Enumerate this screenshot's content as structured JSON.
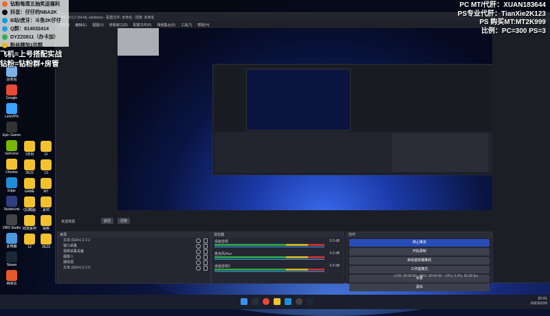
{
  "overlay": {
    "lines": [
      {
        "text": "钻粉每周五抽奖送福利",
        "color": "#e86b2c"
      },
      {
        "text": "抖音：仔仔的NBA2K",
        "color": "#111111"
      },
      {
        "text": "B站/虎牙：斗鱼2K仔仔",
        "color": "#00a1d6"
      },
      {
        "text": "Q群：814032414",
        "color": "#1aa0e6"
      },
      {
        "text": "DYZZ0811（办卡加）",
        "color": "#2bb24c"
      },
      {
        "text": "粉丝牌加1拉群",
        "color": "#e9b616"
      }
    ],
    "promo": [
      "飞机=上号搭配实战",
      "钻粉=钻粉群+房管"
    ]
  },
  "top_right": [
    "PC MT/代肝：XUAN183644",
    "PS专业代肝：TianXie2K123",
    "PS 购买MT:MT2K999",
    "比例：PC=300 PS=3"
  ],
  "desktop": {
    "icons": [
      {
        "label": "回收站",
        "color": "#7fb0e8"
      },
      {
        "label": "Google",
        "color": "#e84a3a"
      },
      {
        "label": "LetsVPN",
        "color": "#3aa2ff"
      },
      {
        "label": "Epic Games",
        "color": "#333333"
      },
      {
        "label": "GeForce",
        "color": "#76b900"
      },
      {
        "label": "Chrome",
        "color": "#f2c12e"
      },
      {
        "label": "Edge",
        "color": "#1f8ed8"
      },
      {
        "label": "StudioLink",
        "color": "#2f3f7f"
      },
      {
        "label": "OBS Studio",
        "color": "#444444"
      },
      {
        "label": "此电脑",
        "color": "#4a9adf"
      },
      {
        "label": "Steam",
        "color": "#1b2838"
      },
      {
        "label": "网易云",
        "color": "#e85a2a"
      }
    ],
    "folders": [
      "1年份",
      "2K22",
      "GAME",
      "QQ截图",
      "收费素材",
      "12",
      "11",
      "13",
      "MT",
      "素材",
      "视频",
      "2K23"
    ]
  },
  "obs": {
    "title": "OBS 29.0.2 (64-bit, windows) - 配置文件: 未命名 - 场景: 未命名",
    "menu": [
      "文件(F)",
      "编辑(E)",
      "视图(V)",
      "停靠窗口(D)",
      "配置文件(P)",
      "场景集合(S)",
      "工具(T)",
      "帮助(H)"
    ],
    "no_source": "未选择源",
    "props_button": "属性",
    "filter_button": "滤镜",
    "scenes_title": "场景",
    "sources_title": "来源",
    "sources": [
      "文本 (GDI+) 2 2 2",
      "窗口采集",
      "视频采集设备",
      "图像 1",
      "媒体源",
      "文本 (GDI+) 2 2 2"
    ],
    "mixer_title": "混音器",
    "mixer": [
      {
        "name": "桌面音频",
        "db": "0.0 dB"
      },
      {
        "name": "麦克风/Aux",
        "db": "0.0 dB"
      },
      {
        "name": "桌面音频2",
        "db": "0.0 dB"
      }
    ],
    "controls_title": "控件",
    "controls": [
      "停止推流",
      "开始录制",
      "启动虚拟摄像机",
      "工作室模式",
      "设置",
      "退出"
    ],
    "status": {
      "live": "LIVE: 00:00:00",
      "rec": "REC: 00:00:00",
      "cpu": "CPU: 2.2%, 60.00 fps"
    }
  },
  "taskbar": {
    "time": "20:01",
    "date": "2023/2/20"
  }
}
